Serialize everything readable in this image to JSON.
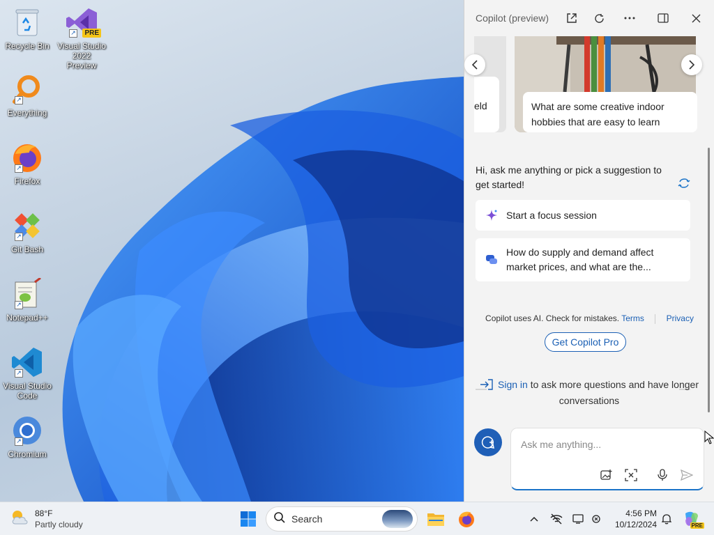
{
  "desktop": {
    "icons": [
      {
        "label": "Recycle Bin",
        "icon": "recycle-bin-icon"
      },
      {
        "label": "Visual Studio 2022 Preview",
        "icon": "visual-studio-icon",
        "badge": "PRE"
      },
      {
        "label": "Everything",
        "icon": "everything-search-icon"
      },
      {
        "label": "Firefox",
        "icon": "firefox-icon"
      },
      {
        "label": "Git Bash",
        "icon": "git-bash-icon"
      },
      {
        "label": "Notepad++",
        "icon": "notepad-plus-plus-icon"
      },
      {
        "label": "Visual Studio Code",
        "icon": "vscode-icon"
      },
      {
        "label": "Chromium",
        "icon": "chromium-icon"
      }
    ]
  },
  "copilot": {
    "title": "Copilot (preview)",
    "header_buttons": [
      "open-in-new-icon",
      "refresh-icon",
      "more-icon",
      "dock-icon",
      "close-icon"
    ],
    "carousel": {
      "left_card_text": "eld",
      "main_card_text": "What are some creative indoor hobbies that are easy to learn"
    },
    "greeting": "Hi, ask me anything or pick a suggestion to get started!",
    "suggestions": [
      {
        "text": "Start a focus session",
        "icon": "sparkle-icon"
      },
      {
        "text": "How do supply and demand affect market prices, and what are the...",
        "icon": "chat-bubbles-icon"
      }
    ],
    "disclaimer": {
      "text": "Copilot uses AI. Check for mistakes.",
      "terms": "Terms",
      "privacy": "Privacy"
    },
    "pro_button": "Get Copilot Pro",
    "signin": {
      "link": "Sign in",
      "text": " to ask more questions and have longer conversations"
    },
    "composer": {
      "placeholder": "Ask me anything...",
      "buttons": [
        "add-image-icon",
        "screenshot-icon",
        "microphone-icon",
        "send-icon"
      ]
    },
    "accent": "#1a5fb4"
  },
  "taskbar": {
    "weather": {
      "temp": "88°F",
      "condition": "Partly cloudy"
    },
    "search_label": "Search",
    "apps": [
      "start-icon",
      "file-explorer-icon",
      "firefox-icon"
    ],
    "tray": [
      "chevron-up-icon",
      "network-off-icon",
      "display-icon",
      "battery-icon",
      "notification-bell-icon",
      "copilot-icon"
    ],
    "clock": {
      "time": "4:56 PM",
      "date": "10/12/2024"
    },
    "copilot_badge": "PRE"
  }
}
